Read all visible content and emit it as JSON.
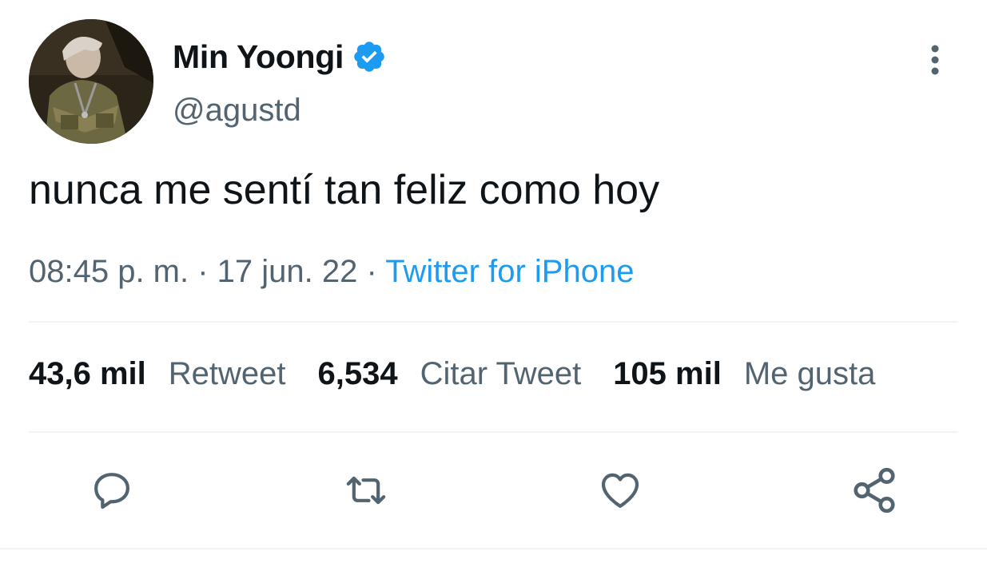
{
  "tweet": {
    "author": {
      "display_name": "Min Yoongi",
      "handle": "@agustd",
      "verified": true,
      "avatar_icon": "profile-photo"
    },
    "text": "nunca me sentí tan feliz como hoy",
    "meta": {
      "time": "08:45 p. m.",
      "sep1": " · ",
      "date": "17 jun. 22",
      "sep2": " · ",
      "source": "Twitter for iPhone"
    },
    "stats": [
      {
        "value": "43,6 mil",
        "label": "Retweet"
      },
      {
        "value": "6,534",
        "label": "Citar Tweet"
      },
      {
        "value": "105 mil",
        "label": "Me gusta"
      }
    ],
    "actions": {
      "reply_icon": "comment-icon",
      "retweet_icon": "retweet-icon",
      "like_icon": "heart-icon",
      "share_icon": "share-icon"
    }
  },
  "colors": {
    "text_primary": "#0f1419",
    "text_secondary": "#536471",
    "accent": "#1d9bf0",
    "divider": "#eff3f4"
  }
}
